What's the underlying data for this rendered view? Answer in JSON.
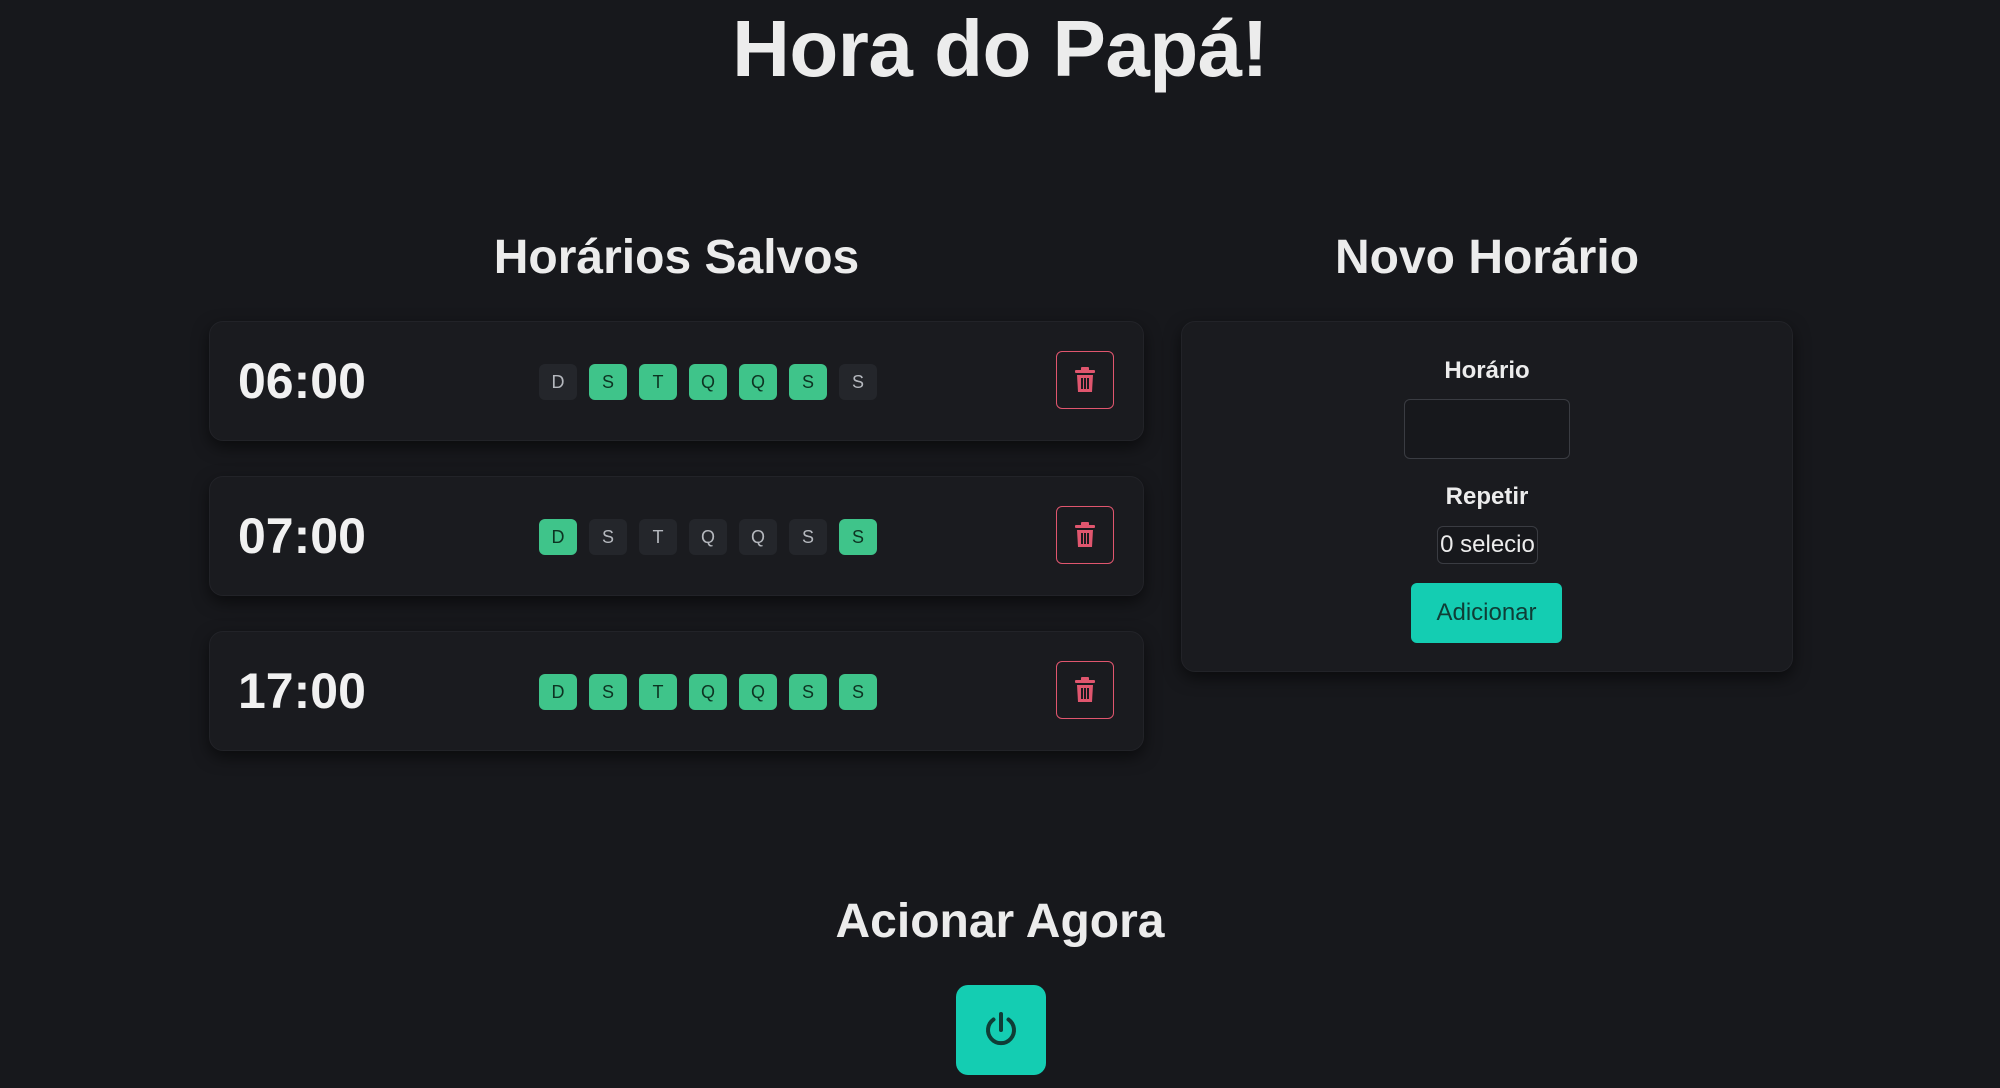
{
  "app": {
    "title": "Hora do Papá!"
  },
  "schedules": {
    "title": "Horários Salvos",
    "items": [
      {
        "time": "06:00",
        "days": [
          {
            "label": "D",
            "active": false
          },
          {
            "label": "S",
            "active": true
          },
          {
            "label": "T",
            "active": true
          },
          {
            "label": "Q",
            "active": true
          },
          {
            "label": "Q",
            "active": true
          },
          {
            "label": "S",
            "active": true
          },
          {
            "label": "S",
            "active": false
          }
        ]
      },
      {
        "time": "07:00",
        "days": [
          {
            "label": "D",
            "active": true
          },
          {
            "label": "S",
            "active": false
          },
          {
            "label": "T",
            "active": false
          },
          {
            "label": "Q",
            "active": false
          },
          {
            "label": "Q",
            "active": false
          },
          {
            "label": "S",
            "active": false
          },
          {
            "label": "S",
            "active": true
          }
        ]
      },
      {
        "time": "17:00",
        "days": [
          {
            "label": "D",
            "active": true
          },
          {
            "label": "S",
            "active": true
          },
          {
            "label": "T",
            "active": true
          },
          {
            "label": "Q",
            "active": true
          },
          {
            "label": "Q",
            "active": true
          },
          {
            "label": "S",
            "active": true
          },
          {
            "label": "S",
            "active": true
          }
        ]
      }
    ],
    "delete_icon": "trash-icon"
  },
  "new_schedule": {
    "title": "Novo Horário",
    "time_label": "Horário",
    "time_value": "",
    "repeat_label": "Repetir",
    "repeat_value": "0 selecio",
    "add_label": "Adicionar"
  },
  "trigger_now": {
    "title": "Acionar Agora",
    "icon": "power-icon"
  },
  "colors": {
    "background": "#17181c",
    "card": "#1a1b1f",
    "accent": "#14cdb2",
    "day_active": "#3fc48a",
    "day_inactive": "#24262b",
    "danger": "#e0566e"
  }
}
